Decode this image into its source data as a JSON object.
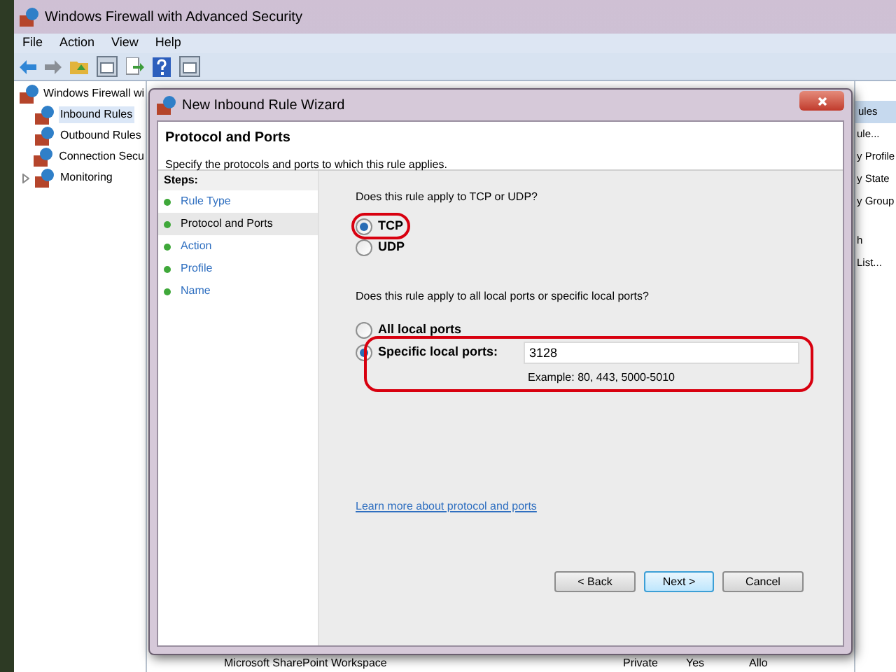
{
  "main_window": {
    "title": "Windows Firewall with Advanced Security",
    "menu": [
      "File",
      "Action",
      "View",
      "Help"
    ],
    "tree": [
      {
        "label": "Windows Firewall wi",
        "selected": false,
        "children": [
          {
            "label": "Inbound Rules",
            "selected": true,
            "expandable": false
          },
          {
            "label": "Outbound Rules",
            "selected": false,
            "expandable": false
          },
          {
            "label": "Connection Secu",
            "selected": false,
            "expandable": false
          },
          {
            "label": "Monitoring",
            "selected": false,
            "expandable": true
          }
        ]
      }
    ],
    "actions": [
      {
        "label": "ules",
        "kind": "header"
      },
      {
        "label": "ule...",
        "kind": "item"
      },
      {
        "label": "y Profile",
        "kind": "item"
      },
      {
        "label": "y State",
        "kind": "item"
      },
      {
        "label": "y Group",
        "kind": "item"
      },
      {
        "label": "h",
        "kind": "item"
      },
      {
        "label": "List...",
        "kind": "item"
      }
    ],
    "rule_row": [
      "Microsoft SharePoint Workspace",
      "Private",
      "Yes",
      "Allo"
    ]
  },
  "dialog": {
    "title": "New Inbound Rule Wizard",
    "heading": "Protocol and Ports",
    "subtitle": "Specify the protocols and ports to which this rule applies.",
    "steps_title": "Steps:",
    "steps": [
      {
        "label": "Rule Type",
        "selected": false
      },
      {
        "label": "Protocol and Ports",
        "selected": true
      },
      {
        "label": "Action",
        "selected": false
      },
      {
        "label": "Profile",
        "selected": false
      },
      {
        "label": "Name",
        "selected": false
      }
    ],
    "protocol_question": "Does this rule apply to TCP or UDP?",
    "protocols": [
      {
        "label": "TCP",
        "selected": true
      },
      {
        "label": "UDP",
        "selected": false
      }
    ],
    "ports_question": "Does this rule apply to all local ports or specific local ports?",
    "ports": [
      {
        "label": "All local ports",
        "selected": false
      },
      {
        "label": "Specific local ports:",
        "selected": true
      }
    ],
    "ports_value": "3128",
    "ports_example": "Example: 80, 443, 5000-5010",
    "link": "Learn more about protocol and ports",
    "buttons": [
      {
        "label": "< Back",
        "default": false
      },
      {
        "label": "Next >",
        "default": true
      },
      {
        "label": "Cancel",
        "default": false
      }
    ]
  }
}
